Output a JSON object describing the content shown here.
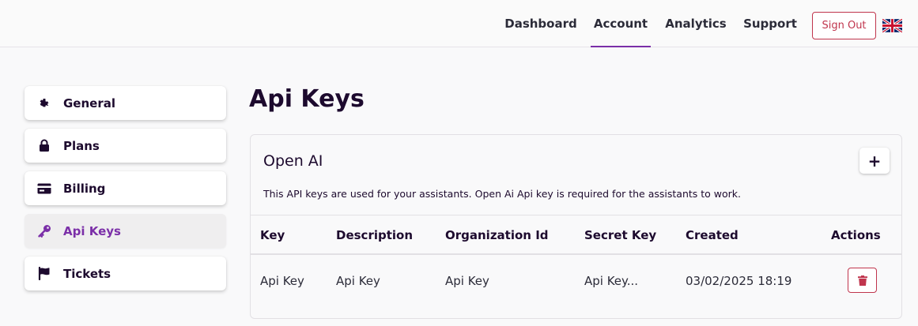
{
  "nav": {
    "items": [
      {
        "label": "Dashboard",
        "active": false
      },
      {
        "label": "Account",
        "active": true
      },
      {
        "label": "Analytics",
        "active": false
      },
      {
        "label": "Support",
        "active": false
      }
    ],
    "sign_out_label": "Sign Out",
    "language_icon": "uk-flag-icon"
  },
  "sidebar": {
    "items": [
      {
        "label": "General",
        "icon": "gear-icon",
        "active": false
      },
      {
        "label": "Plans",
        "icon": "lock-icon",
        "active": false
      },
      {
        "label": "Billing",
        "icon": "credit-card-icon",
        "active": false
      },
      {
        "label": "Api Keys",
        "icon": "key-icon",
        "active": true
      },
      {
        "label": "Tickets",
        "icon": "flag-icon",
        "active": false
      }
    ]
  },
  "page": {
    "title": "Api Keys"
  },
  "card": {
    "title": "Open AI",
    "add_label": "+",
    "description": "This API keys are used for your assistants. Open Ai Api key is required for the assistants to work.",
    "columns": [
      "Key",
      "Description",
      "Organization Id",
      "Secret Key",
      "Created",
      "Actions"
    ],
    "rows": [
      {
        "key": "Api Key",
        "description": "Api Key",
        "organization_id": "Api Key",
        "secret_key": "Api Key...",
        "created": "03/02/2025 18:19"
      }
    ]
  },
  "colors": {
    "accent": "#7b2fa8",
    "danger": "#c0354d",
    "text": "#1d0a2e"
  }
}
